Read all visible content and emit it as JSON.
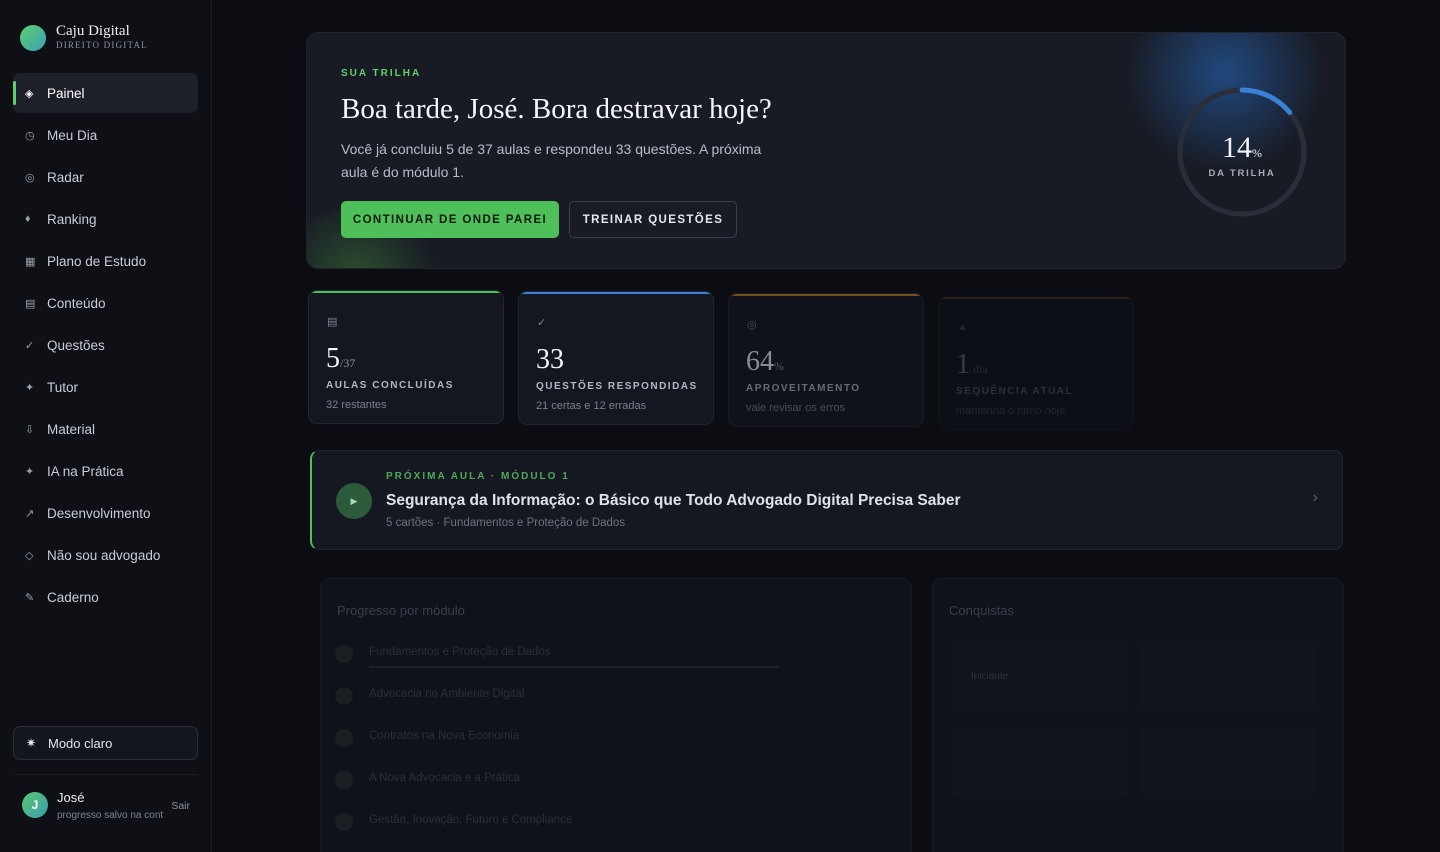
{
  "brand": {
    "name": "Caju Digital",
    "subtitle": "DIREITO DIGITAL"
  },
  "sidebar": {
    "items": [
      {
        "label": "Painel",
        "icon": "diamond-icon",
        "glyph": "◈",
        "active": true
      },
      {
        "label": "Meu Dia",
        "icon": "clock-icon",
        "glyph": "◷"
      },
      {
        "label": "Radar",
        "icon": "radar-icon",
        "glyph": "◎"
      },
      {
        "label": "Ranking",
        "icon": "ranking-icon",
        "glyph": "♦"
      },
      {
        "label": "Plano de Estudo",
        "icon": "calendar-icon",
        "glyph": "▦"
      },
      {
        "label": "Conteúdo",
        "icon": "document-icon",
        "glyph": "▤"
      },
      {
        "label": "Questões",
        "icon": "check-icon",
        "glyph": "✓"
      },
      {
        "label": "Tutor",
        "icon": "sparkle-icon",
        "glyph": "✦"
      },
      {
        "label": "Material",
        "icon": "download-icon",
        "glyph": "⇩"
      },
      {
        "label": "IA na Prática",
        "icon": "sparkle-icon",
        "glyph": "✦"
      },
      {
        "label": "Desenvolvimento",
        "icon": "trend-icon",
        "glyph": "↗"
      },
      {
        "label": "Não sou advogado",
        "icon": "diamond-outline-icon",
        "glyph": "◇"
      },
      {
        "label": "Caderno",
        "icon": "pen-icon",
        "glyph": "✎"
      }
    ],
    "mode_toggle": {
      "label": "Modo claro",
      "icon": "sun-icon",
      "glyph": "✷"
    },
    "user": {
      "initial": "J",
      "name": "José",
      "subtitle": "progresso salvo na cont",
      "logout": "Sair"
    }
  },
  "hero": {
    "eyebrow": "SUA TRILHA",
    "title": "Boa tarde, José. Bora destravar hoje?",
    "description": "Você já concluiu 5 de 37 aulas e respondeu 33 questões. A próxima aula é do módulo 1.",
    "primary_button": "CONTINUAR DE ONDE PAREI",
    "secondary_button": "TREINAR QUESTÕES",
    "progress": {
      "value": "14",
      "unit": "%",
      "fraction": 0.14,
      "label": "DA TRILHA"
    }
  },
  "stats": [
    {
      "icon": "document-icon",
      "glyph": "▤",
      "value": "5",
      "suffix": "/37",
      "label": "AULAS CONCLUÍDAS",
      "sub": "32 restantes",
      "color": "#4fbf59",
      "opacity": 1
    },
    {
      "icon": "check-icon",
      "glyph": "✓",
      "value": "33",
      "suffix": "",
      "label": "QUESTÕES RESPONDIDAS",
      "sub": "21 certas e 12 erradas",
      "color": "#3b82d6",
      "opacity": 1
    },
    {
      "icon": "target-icon",
      "glyph": "◎",
      "value": "64",
      "suffix": "%",
      "label": "APROVEITAMENTO",
      "sub": "vale revisar os erros",
      "color": "#c9892a",
      "opacity": 0.55
    },
    {
      "icon": "flame-icon",
      "glyph": "▲",
      "value": "1",
      "suffix": " dia",
      "label": "SEQUÊNCIA ATUAL",
      "sub": "mantenha o ritmo hoje",
      "color": "#b86a2a",
      "opacity": 0.2
    }
  ],
  "next_lesson": {
    "eyebrow": "PRÓXIMA AULA · MÓDULO 1",
    "title": "Segurança da Informação: o Básico que Todo Advogado Digital Precisa Saber",
    "subtitle": "5 cartões · Fundamentos e Proteção de Dados"
  },
  "progress_panel": {
    "title": "Progresso por módulo",
    "items": [
      "Fundamentos e Proteção de Dados",
      "Advocacia no Ambiente Digital",
      "Contratos na Nova Economia",
      "A Nova Advocacia e a Prática",
      "Gestão, Inovação, Futuro e Compliance"
    ]
  },
  "achievements_panel": {
    "title": "Conquistas",
    "item": "Iniciante"
  }
}
